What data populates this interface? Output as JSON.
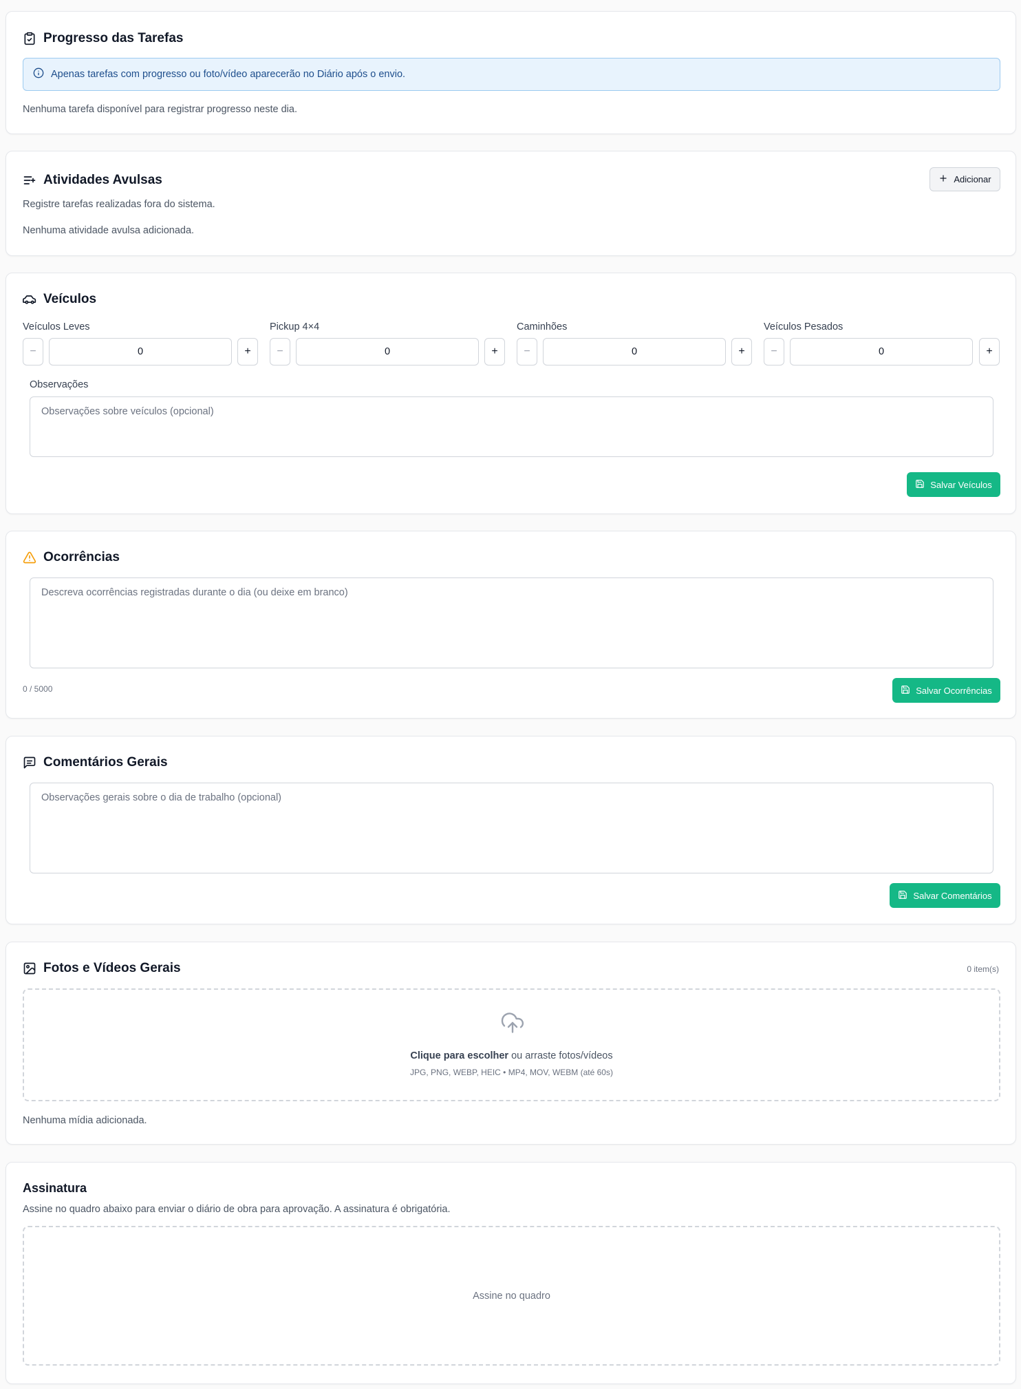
{
  "tasks": {
    "title": "Progresso das Tarefas",
    "icon": "clipboard-check-icon",
    "info": "Apenas tarefas com progresso ou foto/vídeo aparecerão no Diário após o envio.",
    "empty": "Nenhuma tarefa disponível para registrar progresso neste dia."
  },
  "loose": {
    "title": "Atividades Avulsas",
    "icon": "list-plus-icon",
    "add_label": "Adicionar",
    "subtitle": "Registre tarefas realizadas fora do sistema.",
    "empty": "Nenhuma atividade avulsa adicionada."
  },
  "vehicles": {
    "title": "Veículos",
    "icon": "car-icon",
    "fields": [
      {
        "label": "Veículos Leves",
        "value": "0"
      },
      {
        "label": "Pickup 4×4",
        "value": "0"
      },
      {
        "label": "Caminhões",
        "value": "0"
      },
      {
        "label": "Veículos Pesados",
        "value": "0"
      }
    ],
    "minus": "−",
    "plus": "+",
    "notes_label": "Observações",
    "notes_placeholder": "Observações sobre veículos (opcional)",
    "save_label": "Salvar Veículos"
  },
  "occurrences": {
    "title": "Ocorrências",
    "icon": "alert-triangle-icon",
    "placeholder": "Descreva ocorrências registradas durante o dia (ou deixe em branco)",
    "counter": "0 / 5000",
    "save_label": "Salvar Ocorrências"
  },
  "comments": {
    "title": "Comentários Gerais",
    "icon": "message-square-icon",
    "placeholder": "Observações gerais sobre o dia de trabalho (opcional)",
    "save_label": "Salvar Comentários"
  },
  "media": {
    "title": "Fotos e Vídeos Gerais",
    "icon": "image-icon",
    "count": "0 item(s)",
    "upload_bold": "Clique para escolher",
    "upload_rest": " ou arraste fotos/vídeos",
    "formats": "JPG, PNG, WEBP, HEIC • MP4, MOV, WEBM (até 60s)",
    "empty": "Nenhuma mídia adicionada."
  },
  "signature": {
    "title": "Assinatura",
    "subtitle": "Assine no quadro abaixo para enviar o diário de obra para aprovação. A assinatura é obrigatória.",
    "pad_label": "Assine no quadro"
  },
  "colors": {
    "accent_green": "#15b886",
    "info_bg": "#e8f3fd",
    "warning": "#f59e0b"
  }
}
